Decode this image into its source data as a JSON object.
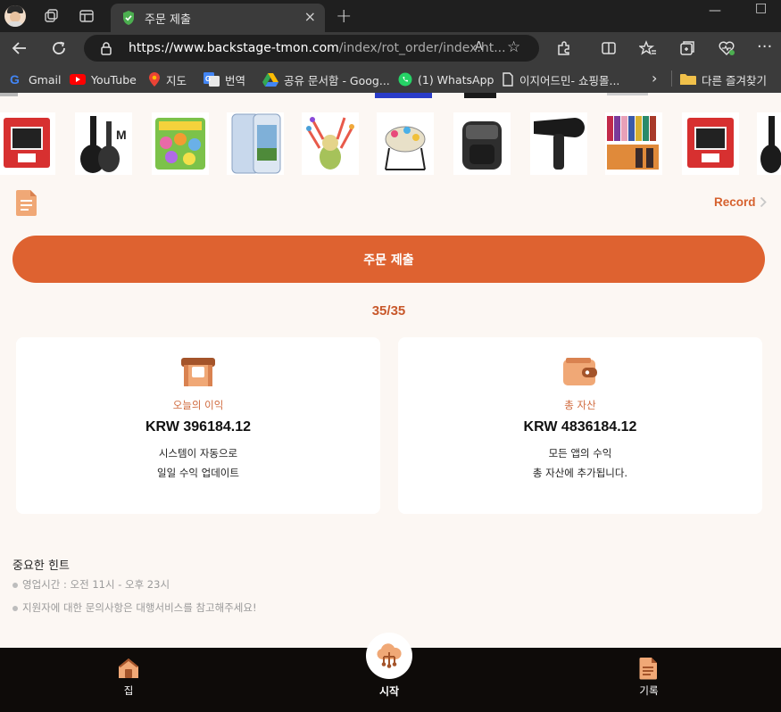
{
  "browser": {
    "tab_title": "주문 제출",
    "url_domain": "https://www.backstage-tmon.com",
    "url_path": "/index/rot_order/index.ht...",
    "reader_label": "A",
    "new_tab_label": "+",
    "close_tab_label": "×",
    "minimize_label": "—",
    "maximize_label": "□"
  },
  "bookmarks": [
    {
      "label": "Gmail",
      "icon": "gmail-icon",
      "color": "#ea4335"
    },
    {
      "label": "YouTube",
      "icon": "youtube-icon",
      "color": "#ff0000"
    },
    {
      "label": "지도",
      "icon": "maps-icon",
      "color": "#34a853"
    },
    {
      "label": "번역",
      "icon": "translate-icon",
      "color": "#4285f4"
    },
    {
      "label": "공유 문서함 - Goog...",
      "icon": "drive-icon",
      "color": "#fbbc04"
    },
    {
      "label": "(1) WhatsApp",
      "icon": "whatsapp-icon",
      "color": "#25d366"
    },
    {
      "label": "이지어드민- 쇼핑몰...",
      "icon": "page-icon",
      "color": "#ffffff"
    },
    {
      "label": "다른 즐겨찾기",
      "icon": "folder-icon",
      "color": "#f0c04a"
    }
  ],
  "page": {
    "record_label": "Record",
    "submit_label": "주문 제출",
    "counter": "35/35",
    "cards": [
      {
        "label": "오늘의 이익",
        "value": "KRW 396184.12",
        "desc_line1": "시스템이 자동으로",
        "desc_line2": "일일 수익 업데이트",
        "icon": "shop-icon"
      },
      {
        "label": "총 자산",
        "value": "KRW 4836184.12",
        "desc_line1": "모든 앱의 수익",
        "desc_line2": "총 자산에 추가됩니다.",
        "icon": "wallet-icon"
      }
    ],
    "hints_title": "중요한 힌트",
    "hints": [
      "영업시간 : 오전 11시 - 오후 23시",
      "지원자에 대한 문의사항은 대행서비스를 참고해주세요!"
    ],
    "products": [
      "game-console",
      "guitar",
      "dinosaur-toys",
      "phone-case",
      "baby-toy",
      "baby-jumper",
      "air-fryer",
      "hair-dryer",
      "nail-polish",
      "game-console",
      "guitar"
    ]
  },
  "bottom_nav": {
    "home_label": "집",
    "start_label": "시작",
    "records_label": "기록"
  },
  "colors": {
    "accent": "#de6230",
    "accent_text": "#c8582b",
    "page_bg": "#fcf7f3",
    "nav_bg": "#0e0b09"
  }
}
